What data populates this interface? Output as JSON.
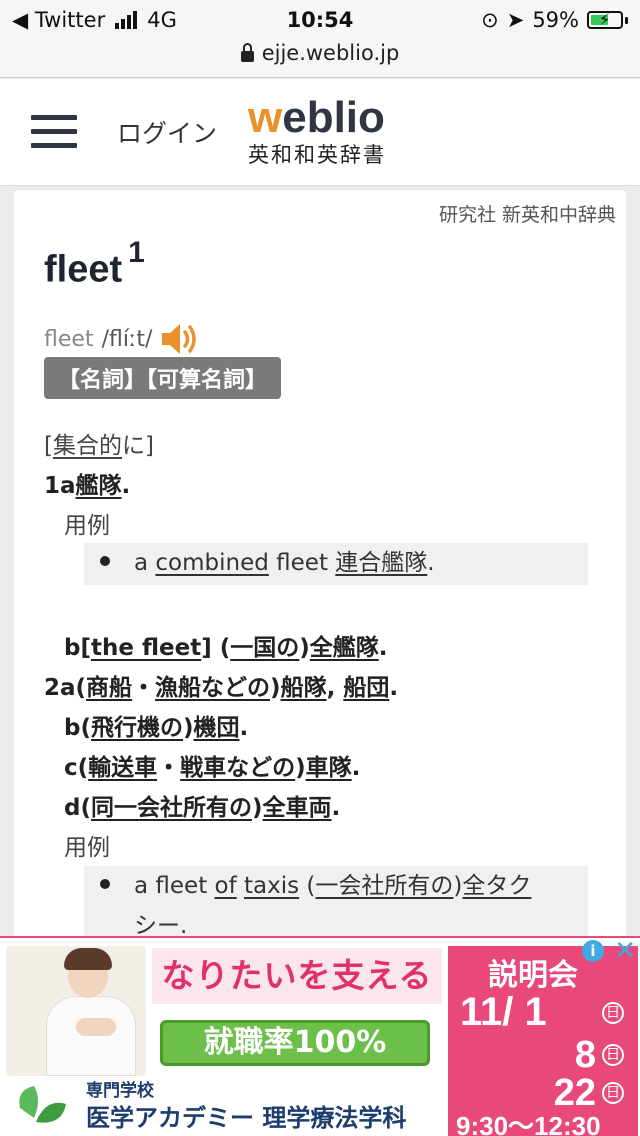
{
  "status_bar": {
    "back_app": "◀ Twitter",
    "network": "4G",
    "time": "10:54",
    "battery": "59%"
  },
  "url_bar": {
    "domain": "ejje.weblio.jp"
  },
  "header": {
    "login": "ログイン",
    "logo_w": "w",
    "logo_rest": "eblio",
    "logo_sub": "英和和英辞書"
  },
  "entry": {
    "source": "研究社 新英和中辞典",
    "headword": "fleet",
    "superscript": "1",
    "pron_word": "fleet",
    "pron_ipa": "/flíːt/",
    "pos": "【名詞】【可算名詞】",
    "usage": {
      "text": "[集合的に]",
      "link": "集合的",
      "pre": "[",
      "post": "に]"
    },
    "sense_1a": {
      "num": "1a",
      "link": "艦隊",
      "post": "."
    },
    "example_label": "用例",
    "example1": {
      "a": "a ",
      "link1": "combined",
      "mid": " fleet ",
      "link2": "連合艦隊",
      "post": "."
    },
    "sense_1b": {
      "num": "b",
      "pre": "[",
      "link1": "the fleet",
      "mid1": "] (",
      "link2": "一国の",
      "mid2": ")",
      "link3": "全艦隊",
      "post": "."
    },
    "sense_2a": {
      "num": "2a",
      "pre": "(",
      "link1": "商船",
      "mid1": "・",
      "link2": "漁船などの",
      "mid2": ")",
      "link3": "船隊",
      "mid3": ", ",
      "link4": "船団",
      "post": "."
    },
    "sense_2b": {
      "num": "b",
      "pre": "(",
      "link1": "飛行機の",
      "mid1": ")",
      "link2": "機団",
      "post": "."
    },
    "sense_2c": {
      "num": "c",
      "pre": "(",
      "link1": "輸送車",
      "mid1": "・",
      "link2": "戦車などの",
      "mid2": ")",
      "link3": "車隊",
      "post": "."
    },
    "sense_2d": {
      "num": "d",
      "pre": "(",
      "link1": "同一会社所有の",
      "mid1": ")",
      "link2": "全車両",
      "post": "."
    },
    "example2_label": "用例",
    "example2": {
      "a": "a fleet ",
      "link1": "of",
      "sp": " ",
      "link2": "taxis",
      "mid": " (",
      "link3": "一会社所有の",
      "mid2": ")",
      "link4": "全タク",
      "line2": "シー."
    }
  },
  "ad": {
    "headline": "なりたいを支える",
    "rate": "就職率100%",
    "school_small": "専門学校",
    "school": "医学アカデミー 理学療法学科",
    "event": "説明会",
    "date1": "11/ 1",
    "date2": "8",
    "date3": "22",
    "day": "日",
    "time": "9:30〜12:30",
    "adchoices": "i",
    "close": "✕",
    "colors": {
      "pink": "#e8497a",
      "green": "#6cc04a",
      "navy": "#1c3d6e"
    }
  }
}
